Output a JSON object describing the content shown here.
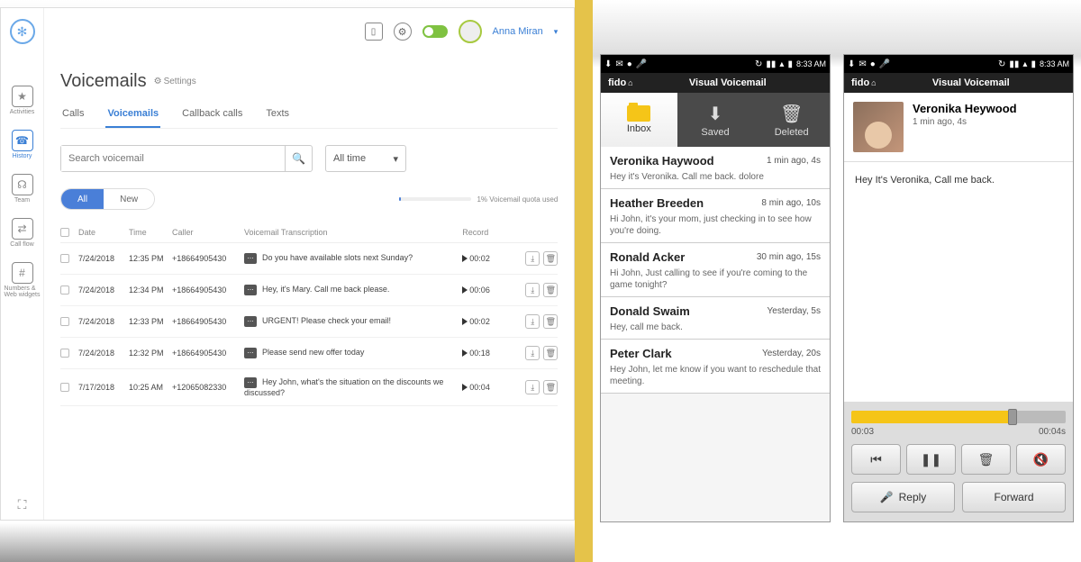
{
  "desktop": {
    "user": "Anna Miran",
    "page_title": "Voicemails",
    "settings_label": "Settings",
    "nav": [
      {
        "label": "Activities",
        "icon": "★"
      },
      {
        "label": "History",
        "icon": "☎"
      },
      {
        "label": "Team",
        "icon": "👤"
      },
      {
        "label": "Call flow",
        "icon": "⇄"
      },
      {
        "label": "Numbers & Web widgets",
        "icon": "#"
      }
    ],
    "tabs": [
      "Calls",
      "Voicemails",
      "Callback calls",
      "Texts"
    ],
    "active_tab": 1,
    "search_placeholder": "Search voicemail",
    "time_filter": "All time",
    "pills": [
      "All",
      "New"
    ],
    "active_pill": 0,
    "quota_text": "1% Voicemail quota used",
    "columns": [
      "",
      "Date",
      "Time",
      "Caller",
      "Voicemail Transcription",
      "Record",
      ""
    ],
    "rows": [
      {
        "date": "7/24/2018",
        "time": "12:35 PM",
        "caller": "+18664905430",
        "trans": "Do you have available slots next Sunday?",
        "dur": "00:02"
      },
      {
        "date": "7/24/2018",
        "time": "12:34 PM",
        "caller": "+18664905430",
        "trans": "Hey, it's Mary. Call me back please.",
        "dur": "00:06"
      },
      {
        "date": "7/24/2018",
        "time": "12:33 PM",
        "caller": "+18664905430",
        "trans": "URGENT! Please check your email!",
        "dur": "00:02"
      },
      {
        "date": "7/24/2018",
        "time": "12:32 PM",
        "caller": "+18664905430",
        "trans": "Please send new offer today",
        "dur": "00:18"
      },
      {
        "date": "7/17/2018",
        "time": "10:25 AM",
        "caller": "+12065082330",
        "trans": "Hey John, what's the situation on the discounts we discussed?",
        "dur": "00:04"
      }
    ]
  },
  "mobile": {
    "statusbar_time": "8:33 AM",
    "carrier": "fido",
    "app_title": "Visual Voicemail",
    "tabs": [
      "Inbox",
      "Saved",
      "Deleted"
    ],
    "list": [
      {
        "name": "Veronika Haywood",
        "meta": "1 min ago, 4s",
        "preview": "Hey it's Veronika.  Call me back. dolore"
      },
      {
        "name": "Heather Breeden",
        "meta": "8 min ago, 10s",
        "preview": "Hi John, it's your mom, just checking in to see how you're doing."
      },
      {
        "name": "Ronald Acker",
        "meta": "30 min ago, 15s",
        "preview": "Hi John, Just calling to see if you're coming to the game tonight?"
      },
      {
        "name": "Donald Swaim",
        "meta": "Yesterday, 5s",
        "preview": "Hey, call me back."
      },
      {
        "name": "Peter Clark",
        "meta": "Yesterday, 20s",
        "preview": "Hey John, let me know if you want to reschedule that meeting."
      }
    ],
    "detail": {
      "name": "Veronika Heywood",
      "meta": "1 min ago, 4s",
      "body": "Hey It's Veronika, Call me back.",
      "elapsed": "00:03",
      "total": "00:04s",
      "reply_label": "Reply",
      "forward_label": "Forward"
    }
  }
}
